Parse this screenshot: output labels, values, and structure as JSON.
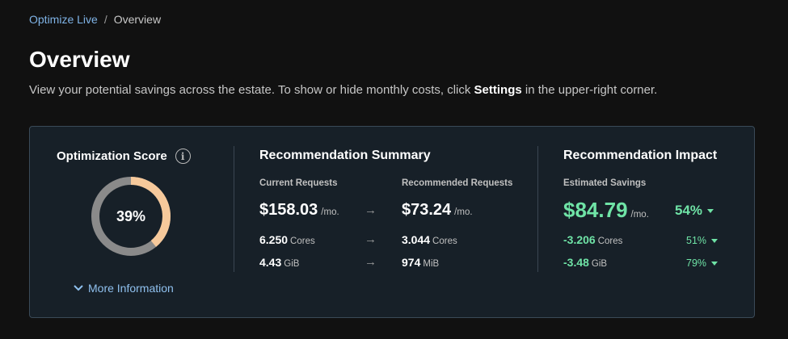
{
  "breadcrumb": {
    "parent": "Optimize Live",
    "separator": "/",
    "current": "Overview"
  },
  "page": {
    "title": "Overview",
    "description_before": "View your potential savings across the estate. To show or hide monthly costs, click ",
    "description_bold": "Settings",
    "description_after": " in the upper-right corner."
  },
  "score": {
    "title": "Optimization Score",
    "info_icon": "info-icon",
    "percent": 39,
    "label": "39%",
    "more_info": "More Information",
    "colors": {
      "filled": "#f6c99b",
      "track": "#8a8a8a"
    }
  },
  "summary": {
    "title": "Recommendation Summary",
    "current_label": "Current Requests",
    "recommended_label": "Recommended Requests",
    "cost_current": "$158.03",
    "cost_recommended": "$73.24",
    "cost_unit": "/mo.",
    "cores_current": "6.250",
    "cores_recommended": "3.044",
    "cores_unit": "Cores",
    "mem_current": "4.43",
    "mem_current_unit": "GiB",
    "mem_recommended": "974",
    "mem_recommended_unit": "MiB",
    "arrow": "→"
  },
  "impact": {
    "title": "Recommendation Impact",
    "label": "Estimated Savings",
    "savings": "$84.79",
    "savings_unit": "/mo.",
    "savings_pct": "54%",
    "cores": "-3.206",
    "cores_unit": "Cores",
    "cores_pct": "51%",
    "mem": "-3.48",
    "mem_unit": "GiB",
    "mem_pct": "79%",
    "accent": "#6fe3a6"
  }
}
